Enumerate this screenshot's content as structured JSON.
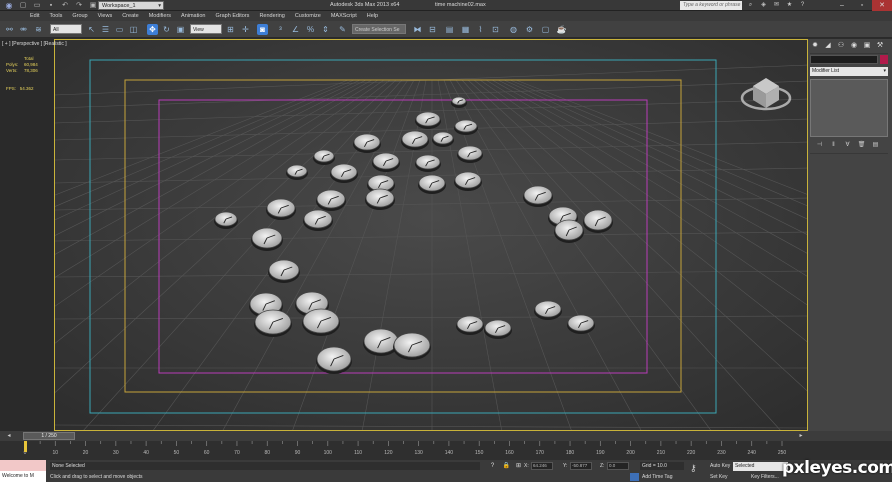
{
  "titlebar": {
    "workspace": "Workspace_1",
    "app_title": "Autodesk 3ds Max  2013 x64",
    "file_title": "time machine02.max",
    "search_placeholder": "Type a keyword or phrase"
  },
  "menu": [
    "Edit",
    "Tools",
    "Group",
    "Views",
    "Create",
    "Modifiers",
    "Animation",
    "Graph Editors",
    "Rendering",
    "Customize",
    "MAXScript",
    "Help"
  ],
  "toolbar": {
    "filter_dropdown": "All",
    "refcoord_dropdown": "View",
    "named_selection": "Create Selection Se"
  },
  "viewport": {
    "label": "[ + ] [Perspective ] [Realistic ]",
    "stats": {
      "header": "Total",
      "polys_label": "Polys:",
      "polys_value": "60,984",
      "verts_label": "Verts:",
      "verts_value": "78,306",
      "fps_label": "FPS:",
      "fps_value": "54.362"
    }
  },
  "command_panel": {
    "modifier_list": "Modifier List"
  },
  "timeline": {
    "frame_display": "1 / 250",
    "ticks": [
      "0",
      "10",
      "20",
      "30",
      "40",
      "50",
      "60",
      "70",
      "80",
      "90",
      "100",
      "110",
      "120",
      "130",
      "140",
      "150",
      "160",
      "170",
      "180",
      "190",
      "200",
      "210",
      "220",
      "230",
      "240",
      "250"
    ]
  },
  "status": {
    "listener": "Welcome to M",
    "selection": "None Selected",
    "prompt": "Click and drag to select and move objects",
    "x_label": "X:",
    "x_value": "64.246",
    "y_label": "Y:",
    "y_value": "-50.877",
    "z_label": "Z:",
    "z_value": "0.0",
    "grid": "Grid = 10.0",
    "add_time_tag": "Add Time Tag",
    "auto_key": "Auto Key",
    "set_key": "Set Key",
    "selected_dropdown": "Selected",
    "key_filters": "Key Filters..."
  },
  "watermark": "pxleyes.com",
  "colors": {
    "viewport_border": "#c9b33a",
    "safe_frame_outer": "#3aa6b4",
    "safe_frame_action": "#c5a33a",
    "safe_frame_title": "#b83cb8",
    "stats_text": "#e8d45c",
    "highlight_icon": "#3d7ed6"
  },
  "icons": {
    "quick_access": [
      "new-icon",
      "open-icon",
      "save-icon",
      "undo-icon",
      "redo-icon",
      "project-icon"
    ],
    "toolbar": [
      "undo-icon",
      "link-icon",
      "unlink-icon",
      "bind-icon",
      "select-icon",
      "select-by-name-icon",
      "rect-region-icon",
      "window-crossing-icon",
      "move-icon",
      "rotate-icon",
      "scale-icon",
      "pivot-icon",
      "manipulate-icon",
      "snap-3d-icon",
      "angle-snap-icon",
      "percent-snap-icon",
      "spinner-snap-icon",
      "edit-named-icon",
      "mirror-icon",
      "align-icon",
      "layer-icon",
      "graphite-icon",
      "curve-editor-icon",
      "schematic-icon",
      "material-editor-icon",
      "render-setup-icon",
      "render-frame-icon",
      "render-icon"
    ],
    "command_tabs": [
      "create-icon",
      "modify-icon",
      "hierarchy-icon",
      "motion-icon",
      "display-icon",
      "utilities-icon"
    ]
  }
}
